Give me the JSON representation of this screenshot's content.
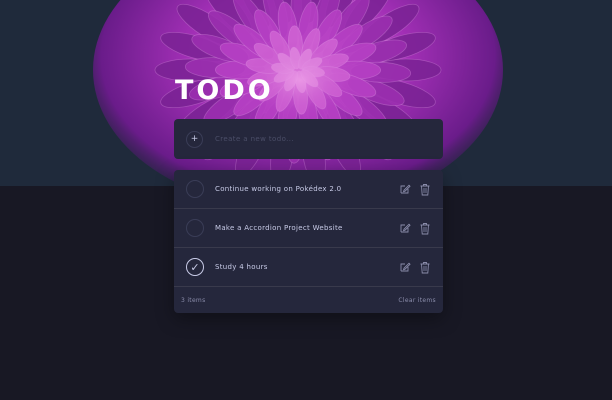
{
  "app": {
    "title": "TODO"
  },
  "new_todo": {
    "placeholder": "Create a new todo...",
    "value": ""
  },
  "todos": [
    {
      "text": "Continue working on Pokédex 2.0",
      "completed": false
    },
    {
      "text": "Make a Accordion Project Website",
      "completed": false
    },
    {
      "text": "Study 4 hours",
      "completed": true
    }
  ],
  "footer": {
    "items_left": "3 items",
    "clear_label": "Clear items"
  },
  "icons": {
    "add": "plus-icon",
    "check": "check-icon",
    "edit": "edit-icon",
    "delete": "trash-icon"
  },
  "colors": {
    "page_background": "#181824",
    "header_background": "#1f2a3b",
    "card_background": "#25273c",
    "text": "#c8cbe7",
    "muted_text": "#8a8caa",
    "divider": "#393a4c",
    "accent_flower": "#9b2fb0"
  }
}
